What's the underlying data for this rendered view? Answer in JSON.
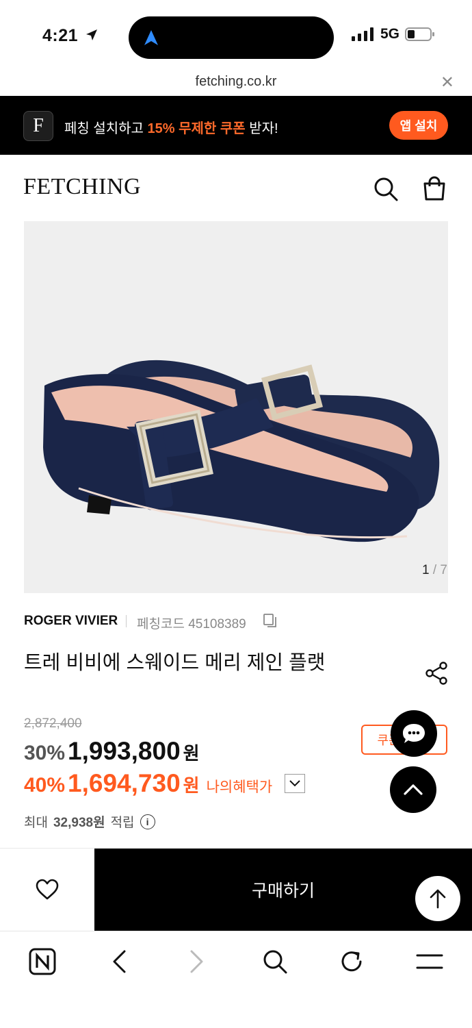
{
  "status_bar": {
    "time": "4:21",
    "network": "5G"
  },
  "browser": {
    "url": "fetching.co.kr"
  },
  "promo_banner": {
    "text_before": "페칭 설치하고 ",
    "highlight": "15% 무제한 쿠폰",
    "text_after": " 받자!",
    "button_label": "앱 설치",
    "logo_letter": "F"
  },
  "header": {
    "logo": "FETCHING"
  },
  "gallery": {
    "current": "1",
    "total": "7"
  },
  "product": {
    "brand": "ROGER VIVIER",
    "code_label": "페칭코드 45108389",
    "title": "트레 비비에 스웨이드 메리 제인 플랫",
    "original_price": "2,872,400",
    "sale_percent": "30%",
    "sale_price": "1,993,800",
    "sale_currency": "원",
    "benefit_percent": "40%",
    "benefit_price": "1,694,730",
    "benefit_currency": "원",
    "benefit_label": "나의혜택가",
    "points_prefix": "최대",
    "points_value": "32,938원",
    "points_suffix": "적립",
    "coupon_label": "쿠폰",
    "info_glyph": "i"
  },
  "actions": {
    "buy_label": "구매하기"
  },
  "colors": {
    "accent": "#ff5a1f",
    "dark": "#000000",
    "product_bg": "#efefef"
  }
}
